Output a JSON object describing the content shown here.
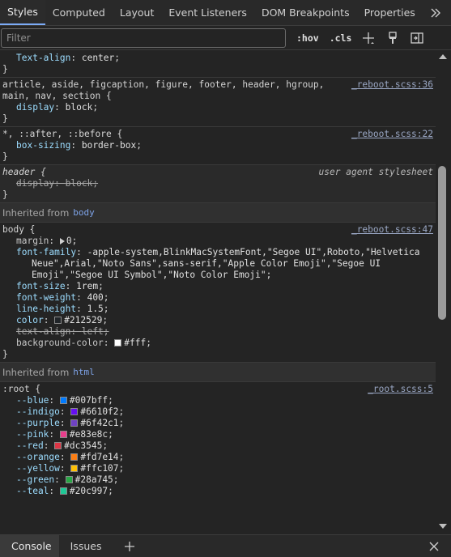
{
  "tabs": [
    {
      "label": "Styles",
      "active": true
    },
    {
      "label": "Computed"
    },
    {
      "label": "Layout"
    },
    {
      "label": "Event Listeners"
    },
    {
      "label": "DOM Breakpoints"
    },
    {
      "label": "Properties"
    }
  ],
  "toolbar": {
    "filter_placeholder": "Filter",
    "hov_label": ":hov",
    "cls_label": ".cls"
  },
  "rules": {
    "r0": {
      "decl_name": "Text-align",
      "decl_value": "center"
    },
    "r1": {
      "selector_line1": "article, aside, figcaption, figure, footer, header, hgroup,",
      "selector_line2": "main, nav, section {",
      "source": "_reboot.scss:36",
      "decl_name": "display",
      "decl_value": "block"
    },
    "r2": {
      "selector": "*, ::after, ::before {",
      "source": "_reboot.scss:22",
      "decl_name": "box-sizing",
      "decl_value": "border-box"
    },
    "r3": {
      "selector": "header {",
      "source": "user agent stylesheet",
      "decl_name": "display",
      "decl_value": "block"
    },
    "inherit_body": {
      "label": "Inherited from",
      "link": "body"
    },
    "r4": {
      "selector": "body {",
      "source": "_reboot.scss:47",
      "margin_name": "margin",
      "margin_value": "0",
      "ff_name": "font-family",
      "ff_line1": "-apple-system,BlinkMacSystemFont,\"Segoe UI\",Roboto,\"Helvetica",
      "ff_line2": "Neue\",Arial,\"Noto Sans\",sans-serif,\"Apple Color Emoji\",\"Segoe UI",
      "ff_line3": "Emoji\",\"Segoe UI Symbol\",\"Noto Color Emoji\";",
      "fs_name": "font-size",
      "fs_value": "1rem",
      "fw_name": "font-weight",
      "fw_value": "400",
      "lh_name": "line-height",
      "lh_value": "1.5",
      "color_name": "color",
      "color_value": "#212529",
      "ta_name": "text-align",
      "ta_value": "left",
      "bg_name": "background-color",
      "bg_value": "#fff"
    },
    "inherit_html": {
      "label": "Inherited from",
      "link": "html"
    },
    "r5": {
      "selector": ":root {",
      "source": "_root.scss:5",
      "vars": [
        {
          "name": "--blue",
          "value": "#007bff"
        },
        {
          "name": "--indigo",
          "value": "#6610f2"
        },
        {
          "name": "--purple",
          "value": "#6f42c1"
        },
        {
          "name": "--pink",
          "value": "#e83e8c"
        },
        {
          "name": "--red",
          "value": "#dc3545"
        },
        {
          "name": "--orange",
          "value": "#fd7e14"
        },
        {
          "name": "--yellow",
          "value": "#ffc107"
        },
        {
          "name": "--green",
          "value": "#28a745"
        },
        {
          "name": "--teal",
          "value": "#20c997"
        }
      ]
    }
  },
  "drawer": {
    "tabs": [
      {
        "label": "Console",
        "active": true
      },
      {
        "label": "Issues"
      }
    ]
  }
}
